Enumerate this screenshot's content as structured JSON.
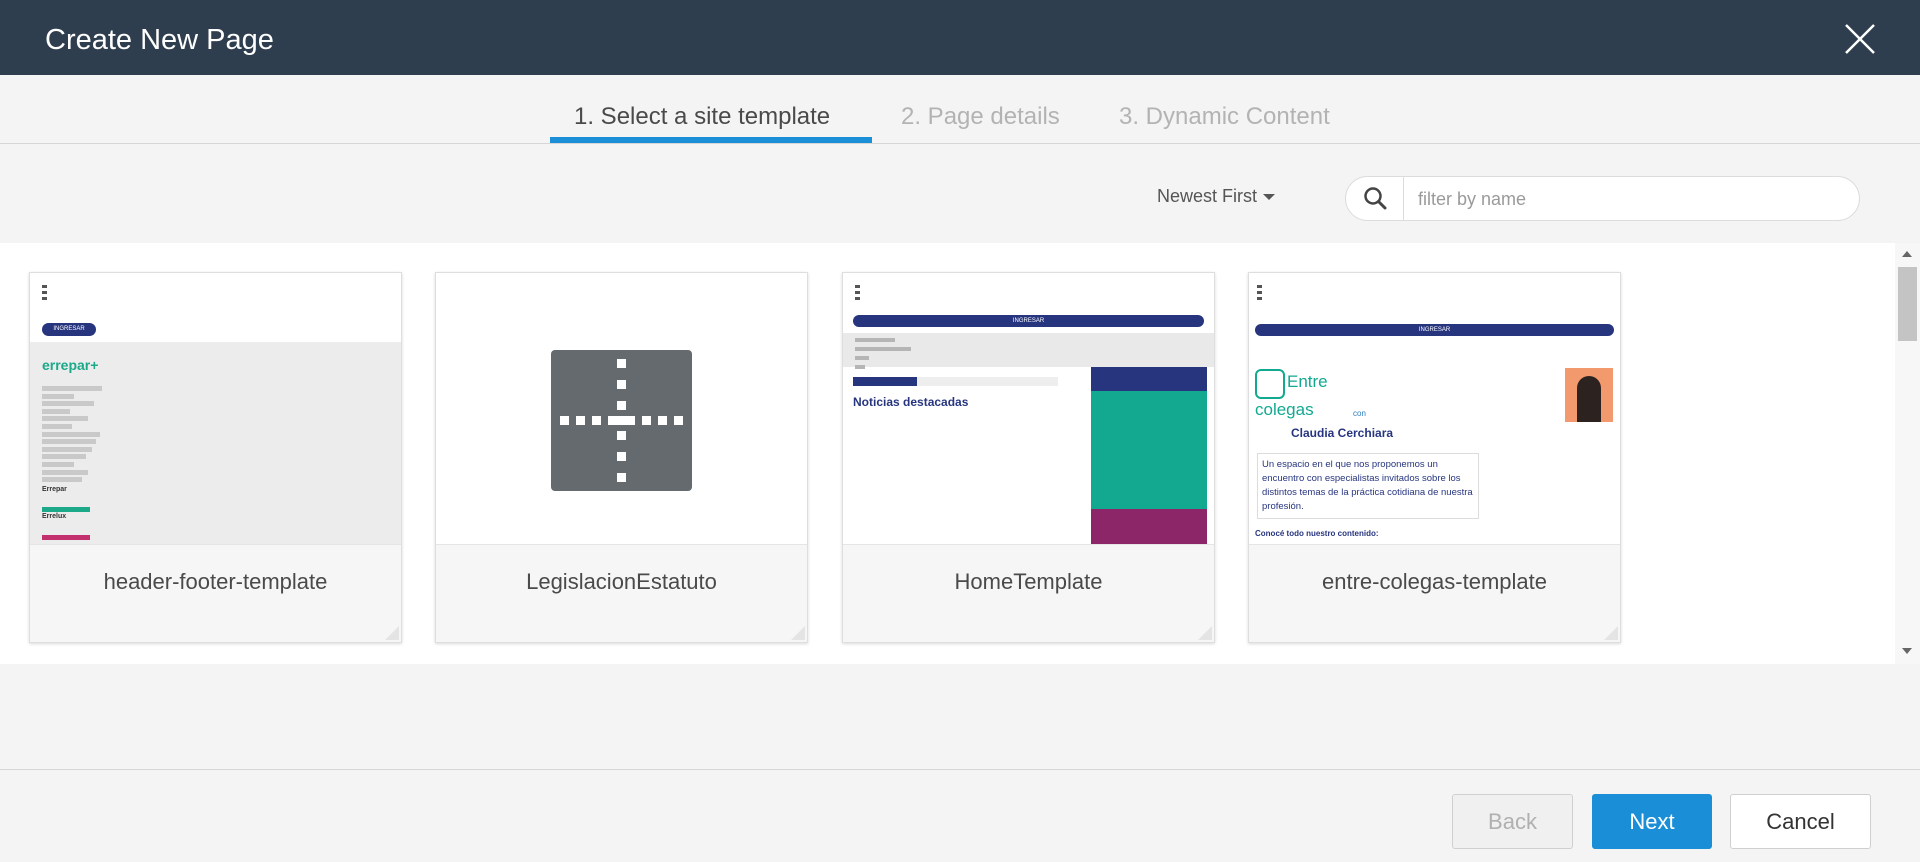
{
  "dialog": {
    "title": "Create New Page"
  },
  "steps": [
    {
      "label": "1. Select a site template",
      "active": true
    },
    {
      "label": "2. Page details",
      "active": false
    },
    {
      "label": "3. Dynamic Content",
      "active": false
    }
  ],
  "toolbar": {
    "sort_label": "Newest First",
    "search_placeholder": "filter by name",
    "search_value": ""
  },
  "templates": [
    {
      "name": "header-footer-template",
      "thumb": "header-footer-preview"
    },
    {
      "name": "LegislacionEstatuto",
      "thumb": "blank-template-icon"
    },
    {
      "name": "HomeTemplate",
      "thumb": "home-preview"
    },
    {
      "name": "entre-colegas-template",
      "thumb": "entre-colegas-preview"
    }
  ],
  "thumbs": {
    "t1": {
      "button": "INGRESAR",
      "logo": "errepar+",
      "section1": "Errepar",
      "section2": "Errelux"
    },
    "t3": {
      "button": "INGRESAR",
      "headline": "Noticias destacadas"
    },
    "t4": {
      "button": "INGRESAR",
      "title_line1": "Entre",
      "title_line2": "colegas",
      "con": "con",
      "person": "Claudia Cerchiara",
      "description": "Un espacio en el que nos proponemos un encuentro con especialistas invitados sobre los distintos temas de la práctica cotidiana de nuestra profesión.",
      "cta": "Conocé todo nuestro contenido:"
    }
  },
  "footer": {
    "back_label": "Back",
    "next_label": "Next",
    "cancel_label": "Cancel"
  },
  "colors": {
    "header_bg": "#2f3e4e",
    "accent": "#1a8ed6"
  }
}
